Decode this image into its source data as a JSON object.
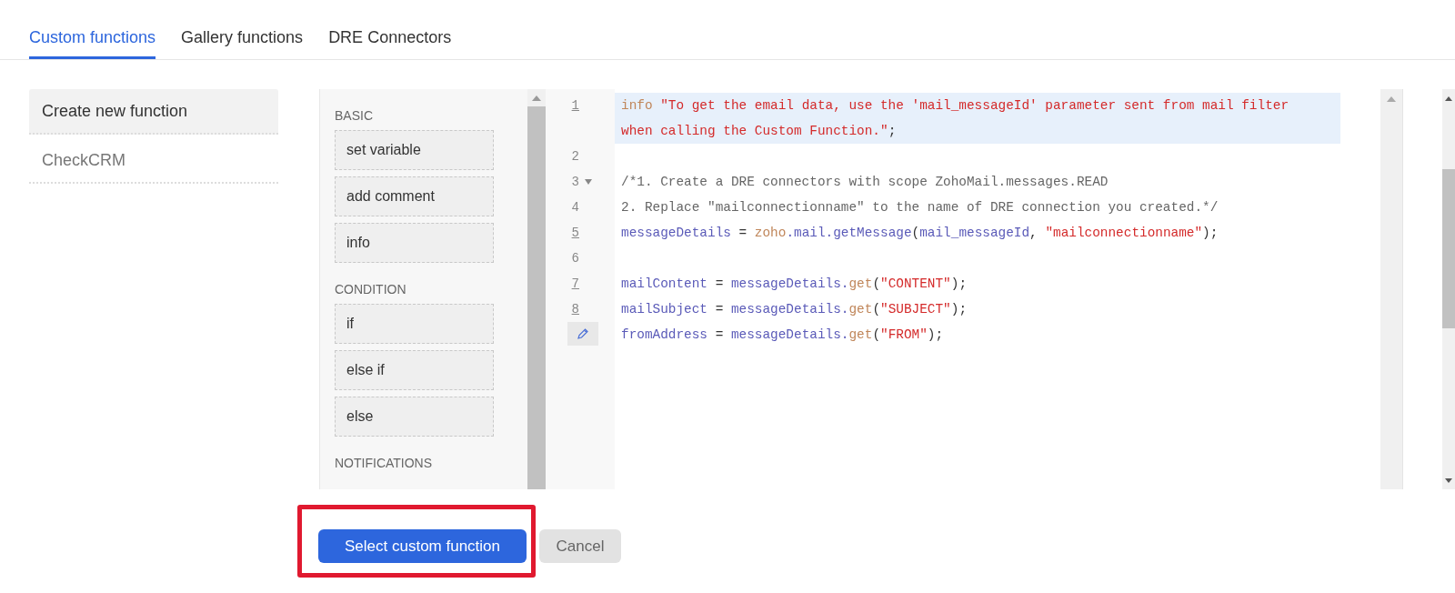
{
  "tabs": [
    {
      "label": "Custom functions",
      "selected": true
    },
    {
      "label": "Gallery functions",
      "selected": false
    },
    {
      "label": "DRE Connectors",
      "selected": false
    }
  ],
  "functions": [
    {
      "label": "Create new function",
      "selected": true
    },
    {
      "label": "CheckCRM",
      "selected": false
    }
  ],
  "palette": {
    "sections": [
      {
        "title": "BASIC",
        "items": [
          "set variable",
          "add comment",
          "info"
        ]
      },
      {
        "title": "CONDITION",
        "items": [
          "if",
          "else if",
          "else"
        ]
      },
      {
        "title": "NOTIFICATIONS"
      }
    ]
  },
  "editor": {
    "lines": [
      {
        "kind": "numbered",
        "number": "1",
        "underlined": true,
        "highlighted": true,
        "foldable": false,
        "tokens": [
          {
            "kind": "builtin",
            "text": "info"
          },
          {
            "kind": "string",
            "text": " \"To get the email data, use the 'mail_messageId' parameter sent from mail filter when calling the Custom Function.\""
          },
          {
            "kind": "plain",
            "text": ";"
          }
        ]
      },
      {
        "kind": "numbered",
        "number": "2",
        "underlined": false,
        "highlighted": false,
        "foldable": false
      },
      {
        "kind": "numbered",
        "number": "3",
        "underlined": false,
        "highlighted": false,
        "foldable": true,
        "tokens": [
          {
            "kind": "comment",
            "text": "/*1. Create a DRE connectors with scope ZohoMail.messages.READ"
          }
        ]
      },
      {
        "kind": "numbered",
        "number": "4",
        "underlined": false,
        "highlighted": false,
        "foldable": false,
        "tokens": [
          {
            "kind": "comment",
            "text": "2. Replace \"mailconnectionname\" to the name of DRE connection you created.*/"
          }
        ]
      },
      {
        "kind": "numbered",
        "number": "5",
        "underlined": true,
        "highlighted": false,
        "foldable": false,
        "tokens": [
          {
            "kind": "ident",
            "text": "messageDetails"
          },
          {
            "kind": "plain",
            "text": " = "
          },
          {
            "kind": "builtin",
            "text": "zoho"
          },
          {
            "kind": "ident",
            "text": ".mail.getMessage"
          },
          {
            "kind": "plain",
            "text": "("
          },
          {
            "kind": "ident",
            "text": "mail_messageId"
          },
          {
            "kind": "plain",
            "text": ", "
          },
          {
            "kind": "string",
            "text": "\"mailconnectionname\""
          },
          {
            "kind": "plain",
            "text": ");"
          }
        ]
      },
      {
        "kind": "numbered",
        "number": "6",
        "underlined": false,
        "highlighted": false,
        "foldable": false
      },
      {
        "kind": "numbered",
        "number": "7",
        "underlined": true,
        "highlighted": false,
        "foldable": false,
        "tokens": [
          {
            "kind": "ident",
            "text": "mailContent"
          },
          {
            "kind": "plain",
            "text": " = "
          },
          {
            "kind": "ident",
            "text": "messageDetails."
          },
          {
            "kind": "builtin",
            "text": "get"
          },
          {
            "kind": "plain",
            "text": "("
          },
          {
            "kind": "string",
            "text": "\"CONTENT\""
          },
          {
            "kind": "plain",
            "text": ");"
          }
        ]
      },
      {
        "kind": "numbered",
        "number": "8",
        "underlined": true,
        "highlighted": false,
        "foldable": false,
        "tokens": [
          {
            "kind": "ident",
            "text": "mailSubject"
          },
          {
            "kind": "plain",
            "text": " = "
          },
          {
            "kind": "ident",
            "text": "messageDetails."
          },
          {
            "kind": "builtin",
            "text": "get"
          },
          {
            "kind": "plain",
            "text": "("
          },
          {
            "kind": "string",
            "text": "\"SUBJECT\""
          },
          {
            "kind": "plain",
            "text": ");"
          }
        ]
      },
      {
        "kind": "edit-marker",
        "highlighted": false,
        "foldable": false,
        "tokens": [
          {
            "kind": "ident",
            "text": "fromAddress"
          },
          {
            "kind": "plain",
            "text": " = "
          },
          {
            "kind": "ident",
            "text": "messageDetails."
          },
          {
            "kind": "builtin",
            "text": "get"
          },
          {
            "kind": "plain",
            "text": "("
          },
          {
            "kind": "string",
            "text": "\"FROM\""
          },
          {
            "kind": "plain",
            "text": ");"
          }
        ]
      }
    ]
  },
  "actions": {
    "primary": "Select custom function",
    "secondary": "Cancel"
  }
}
